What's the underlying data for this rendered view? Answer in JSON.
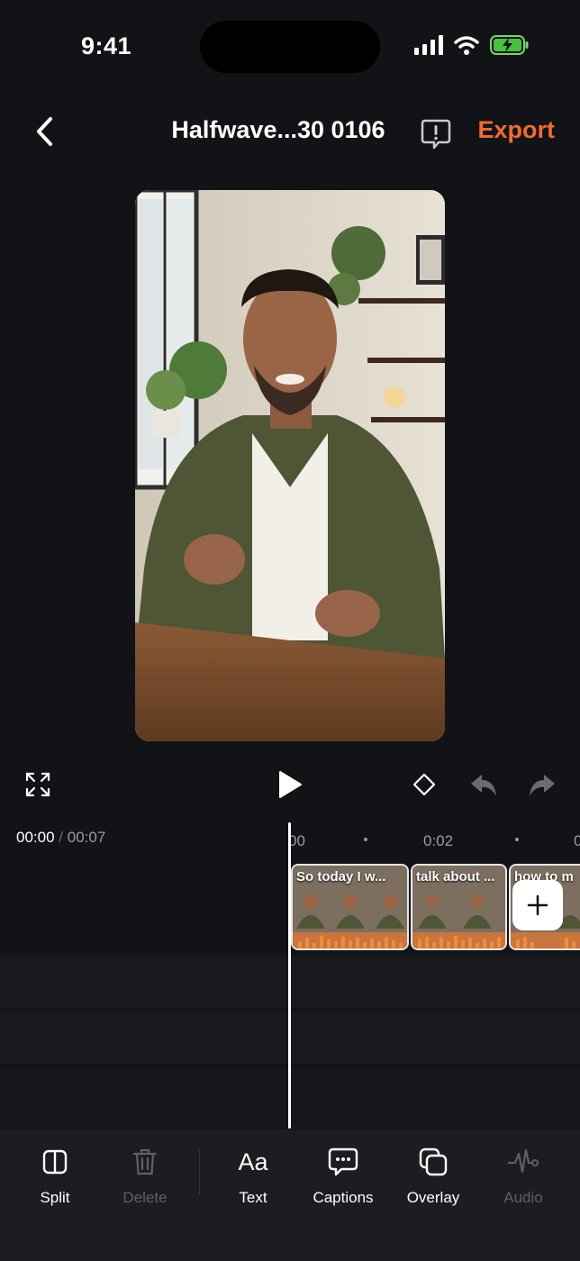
{
  "status": {
    "time": "9:41"
  },
  "header": {
    "title": "Halfwave...30 0106",
    "export_label": "Export"
  },
  "playback": {
    "current": "00:00",
    "separator": "/",
    "total": "00:07"
  },
  "ruler": {
    "labels": [
      "00",
      "0:02",
      "0"
    ]
  },
  "clips": [
    {
      "caption": "So today I w..."
    },
    {
      "caption": "talk about ..."
    },
    {
      "caption": "how to m"
    }
  ],
  "toolbar": {
    "items": [
      {
        "label": "Split",
        "icon": "split-icon",
        "enabled": true
      },
      {
        "label": "Delete",
        "icon": "trash-icon",
        "enabled": false
      },
      {
        "label": "Text",
        "icon": "text-icon",
        "glyph": "Aa",
        "enabled": true
      },
      {
        "label": "Captions",
        "icon": "captions-icon",
        "enabled": true
      },
      {
        "label": "Overlay",
        "icon": "overlay-icon",
        "enabled": true
      },
      {
        "label": "Audio",
        "icon": "audio-icon",
        "enabled": false
      }
    ]
  },
  "colors": {
    "accent": "#F26A2E",
    "background": "#121316",
    "disabled": "#5d6066"
  }
}
